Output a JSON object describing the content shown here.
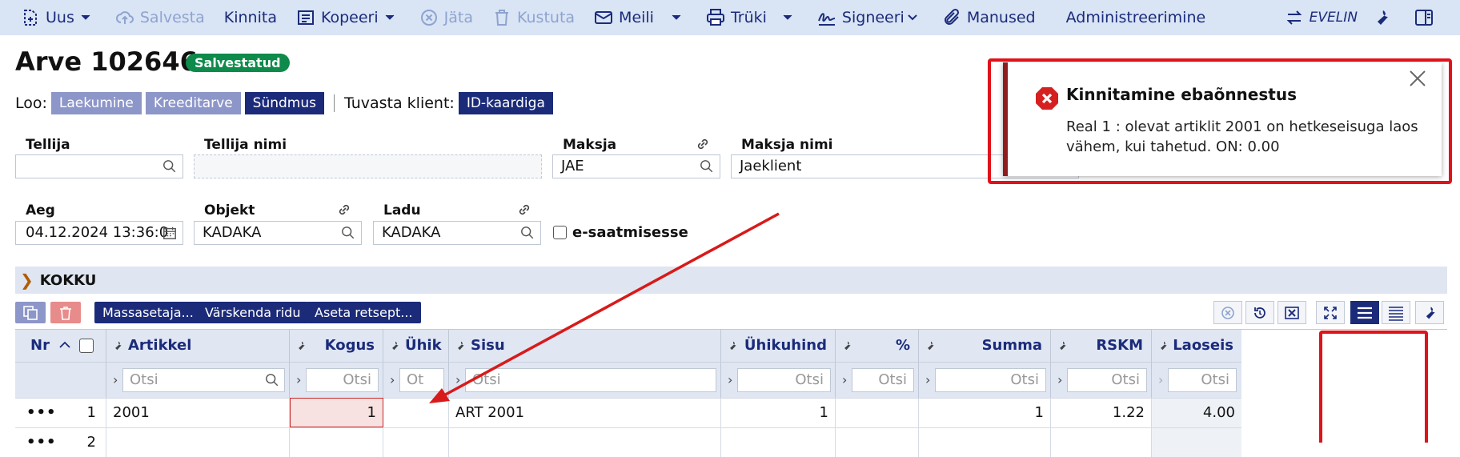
{
  "toolbar": {
    "uus": "Uus",
    "salvesta": "Salvesta",
    "kinnita": "Kinnita",
    "kopeeri": "Kopeeri",
    "jata": "Jäta",
    "kustuta": "Kustuta",
    "meili": "Meili",
    "truki": "Trüki",
    "signeeri": "Signeeri",
    "manused": "Manused",
    "administreerimine": "Administreerimine",
    "user": "EVELIN"
  },
  "header": {
    "title": "Arve 102646",
    "status": "Salvestatud",
    "loo_label": "Loo:",
    "loo_items": [
      "Laekumine",
      "Kreeditarve",
      "Sündmus"
    ],
    "tuvasta_label": "Tuvasta klient:",
    "tuvasta_button": "ID-kaardiga"
  },
  "fields": {
    "tellija_label": "Tellija",
    "tellija_value": "",
    "tellija_nimi_label": "Tellija nimi",
    "tellija_nimi_value": "",
    "maksja_label": "Maksja",
    "maksja_value": "JAE",
    "maksja_nimi_label": "Maksja nimi",
    "maksja_nimi_value": "Jaeklient",
    "aeg_label": "Aeg",
    "aeg_value": "04.12.2024 13:36:0",
    "objekt_label": "Objekt",
    "objekt_value": "KADAKA",
    "ladu_label": "Ladu",
    "ladu_value": "KADAKA",
    "esaatmisesse_label": "e-saatmisesse"
  },
  "kokku": {
    "label": "KOKKU"
  },
  "grid_toolbar": {
    "massasetaja": "Massasetaja...",
    "varskenda": "Värskenda ridu",
    "aseta": "Aseta retsept..."
  },
  "table": {
    "columns": [
      "Nr",
      "Artikkel",
      "Kogus",
      "Ühik",
      "Sisu",
      "Ühikuhind",
      "%",
      "Summa",
      "RSKM",
      "Laoseis"
    ],
    "filter_placeholder": "Otsi",
    "unit_filter_placeholder": "Ot",
    "rows": [
      {
        "menu": "•••",
        "nr": "1",
        "artikkel": "2001",
        "kogus": "1",
        "uhik": "",
        "sisu": "ART 2001",
        "uhikuhind": "1",
        "protsent": "",
        "summa": "1",
        "rskm": "1.22",
        "laoseis": "4.00"
      },
      {
        "menu": "•••",
        "nr": "2",
        "artikkel": "",
        "kogus": "",
        "uhik": "",
        "sisu": "",
        "uhikuhind": "",
        "protsent": "",
        "summa": "",
        "rskm": "",
        "laoseis": ""
      }
    ]
  },
  "toast": {
    "title": "Kinnitamine ebaõnnestus",
    "message": "Real 1 : olevat artiklit 2001 on hetkeseisuga laos vähem, kui tahetud. ON: 0.00"
  },
  "colors": {
    "brand": "#1b2b7a",
    "toolbar_bg": "#d9e4f5",
    "success": "#0e8a4b",
    "error": "#d62020",
    "highlight": "#e0121a"
  }
}
